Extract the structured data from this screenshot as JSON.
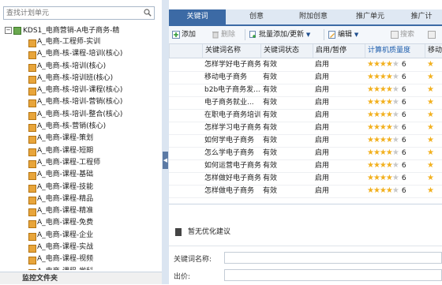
{
  "left": {
    "search_placeholder": "查找计划单元",
    "root_label": "KDS1_电商营销-A电子商务-精",
    "items": [
      "A_电商-工程师-实训",
      "A_电商-核-课程-培训(核心)",
      "A_电商-核-培训(核心)",
      "A_电商-核-培训班(核心)",
      "A_电商-核-培训-课程(核心)",
      "A_电商-核-培训-营销(核心)",
      "A_电商-核-培训-整合(核心)",
      "A_电商-核-营销(核心)",
      "A_电商-课程-策划",
      "A_电商-课程-短期",
      "A_电商-课程-工程师",
      "A_电商-课程-基础",
      "A_电商-课程-技能",
      "A_电商-课程-精品",
      "A_电商-课程-精准",
      "A_电商-课程-免费",
      "A_电商-课程-企业",
      "A_电商-课程-实战",
      "A_电商-课程-视频",
      "A_电商-课程-学科"
    ],
    "bottom_label": "监控文件夹"
  },
  "tabs": [
    "关键词",
    "创意",
    "附加创意",
    "推广单元",
    "推广计"
  ],
  "toolbar": {
    "add": "添加",
    "delete": "删除",
    "batch": "批量添加/更新",
    "edit": "编辑",
    "search": "搜索"
  },
  "grid": {
    "headers": [
      "关键词名称",
      "关键词状态",
      "启用/暂停",
      "计算机质量度",
      "移动"
    ],
    "rows": [
      {
        "name": "怎样学好电子商务",
        "status": "有效",
        "enable": "启用",
        "quality": 6
      },
      {
        "name": "移动电子商务",
        "status": "有效",
        "enable": "启用",
        "quality": 6
      },
      {
        "name": "b2b电子商务发...",
        "status": "有效",
        "enable": "启用",
        "quality": 6
      },
      {
        "name": "电子商务就业...",
        "status": "有效",
        "enable": "启用",
        "quality": 6
      },
      {
        "name": "在职电子商务培训",
        "status": "有效",
        "enable": "启用",
        "quality": 6
      },
      {
        "name": "怎样学习电子商务",
        "status": "有效",
        "enable": "启用",
        "quality": 6
      },
      {
        "name": "如何学电子商务",
        "status": "有效",
        "enable": "启用",
        "quality": 6
      },
      {
        "name": "怎么学电子商务",
        "status": "有效",
        "enable": "启用",
        "quality": 6
      },
      {
        "name": "如何运营电子商务",
        "status": "有效",
        "enable": "启用",
        "quality": 6
      },
      {
        "name": "怎样做好电子商务",
        "status": "有效",
        "enable": "启用",
        "quality": 6
      },
      {
        "name": "怎样做电子商务",
        "status": "有效",
        "enable": "启用",
        "quality": 6
      }
    ]
  },
  "lower": {
    "advice": "暂无优化建议",
    "field1": "关键词名称:",
    "field2": "出价:"
  },
  "colors": {
    "accent": "#3c6aa5",
    "star": "#f2b01e"
  }
}
